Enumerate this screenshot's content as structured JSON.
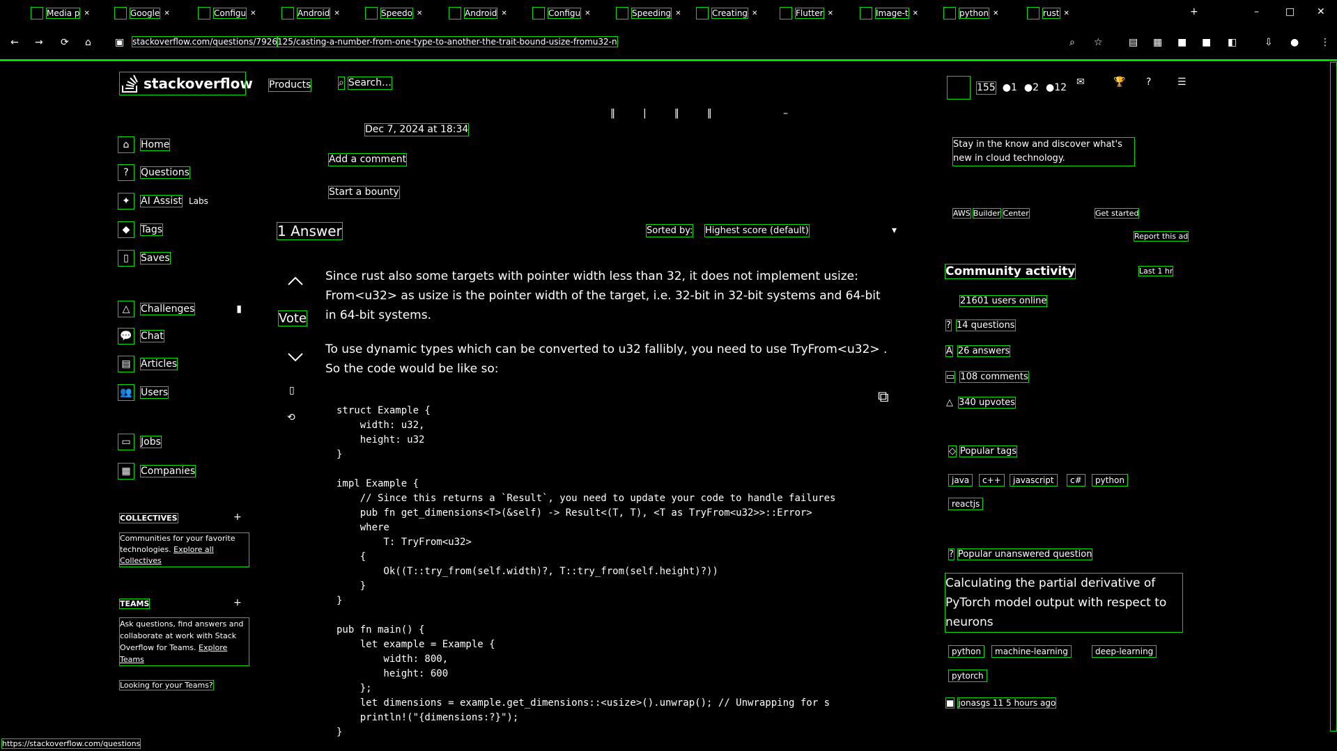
{
  "browser": {
    "tabs": [
      {
        "label": "Media p"
      },
      {
        "label": "Google"
      },
      {
        "label": "Configu"
      },
      {
        "label": "Android"
      },
      {
        "label": "Speedo"
      },
      {
        "label": "Android"
      },
      {
        "label": "Configu"
      },
      {
        "label": "Speeding"
      },
      {
        "label": "Creating"
      },
      {
        "label": "Flutter"
      },
      {
        "label": "Image-t"
      },
      {
        "label": "python"
      },
      {
        "label": "rust"
      }
    ],
    "url_host": "stackoverflow.com/questions/7926",
    "url_path": "125/casting-a-number-from-one-type-to-another-the-trait-bound-usize-fromu32-n",
    "status_url": "https://stackoverflow.com/questions"
  },
  "header": {
    "logo": "stackoverflow",
    "products": "Products",
    "search_placeholder": "Search…",
    "rep": "155",
    "badges": [
      "1",
      "2",
      "12"
    ]
  },
  "sidebar": {
    "items": [
      {
        "label": "Home"
      },
      {
        "label": "Questions"
      },
      {
        "label": "AI Assist",
        "badge": "Labs"
      },
      {
        "label": "Tags"
      },
      {
        "label": "Saves"
      },
      {
        "label": "Challenges"
      },
      {
        "label": "Chat"
      },
      {
        "label": "Articles"
      },
      {
        "label": "Users"
      },
      {
        "label": "Jobs"
      },
      {
        "label": "Companies"
      }
    ],
    "collectives_title": "COLLECTIVES",
    "collectives_text": "Communities for your favorite technologies.",
    "collectives_link": "Explore all Collectives",
    "teams_title": "TEAMS",
    "teams_text": "Ask questions, find answers and collaborate at work with Stack Overflow for Teams.",
    "teams_link": "Explore Teams",
    "teams_footer": "Looking for your Teams?"
  },
  "question": {
    "asked_date": "Dec 7, 2024 at 18:34",
    "add_comment": "Add a comment",
    "start_bounty": "Start a bounty"
  },
  "answers": {
    "count_label": "1 Answer",
    "sorted_by": "Sorted by:",
    "sort_value": "Highest score (default)",
    "vote_label": "Vote",
    "p1": "Since rust also some targets with pointer width less than 32, it does not implement usize: From<u32> as usize is the pointer width of the target, i.e. 32-bit in 32-bit systems and 64-bit in 64-bit systems.",
    "p2": "To use dynamic types which can be converted to u32 fallibly, you need to use TryFrom<u32> . So the code would be like so:",
    "code": [
      "struct Example {",
      "    width: u32,",
      "    height: u32",
      "}",
      "",
      "impl Example {",
      "    // Since this returns a `Result`, you need to update your code to handle failures",
      "    pub fn get_dimensions<T>(&self) -> Result<(T, T), <T as TryFrom<u32>>::Error>",
      "    where",
      "        T: TryFrom<u32>",
      "    {",
      "        Ok((T::try_from(self.width)?, T::try_from(self.height)?))",
      "    }",
      "}",
      "",
      "pub fn main() {",
      "    let example = Example {",
      "        width: 800,",
      "        height: 600",
      "    };",
      "    let dimensions = example.get_dimensions::<usize>().unwrap(); // Unwrapping for s",
      "    println!(\"{dimensions:?}\");",
      "}"
    ]
  },
  "right": {
    "ad_text": "Stay in the know and discover what's new in cloud technology.",
    "ad_links": [
      "AWS",
      "Builder",
      "Center"
    ],
    "ad_cta": "Get started",
    "report_ad": "Report this ad",
    "community_title": "Community activity",
    "last_hr": "Last 1 hr",
    "online": "21601 users online",
    "stats": [
      {
        "label": "14 questions"
      },
      {
        "label": "26 answers"
      },
      {
        "label": "108 comments"
      },
      {
        "label": "340 upvotes"
      }
    ],
    "popular_tags_title": "Popular tags",
    "popular_tags": [
      "java",
      "c++",
      "javascript",
      "c#",
      "python",
      "reactjs"
    ],
    "unanswered_title": "Popular unanswered question",
    "unanswered_question": "Calculating the partial derivative of PyTorch model output with respect to neurons",
    "unanswered_tags": [
      "python",
      "machine-learning",
      "deep-learning",
      "pytorch"
    ],
    "unanswered_meta": "jonasgs 11 5 hours ago"
  }
}
